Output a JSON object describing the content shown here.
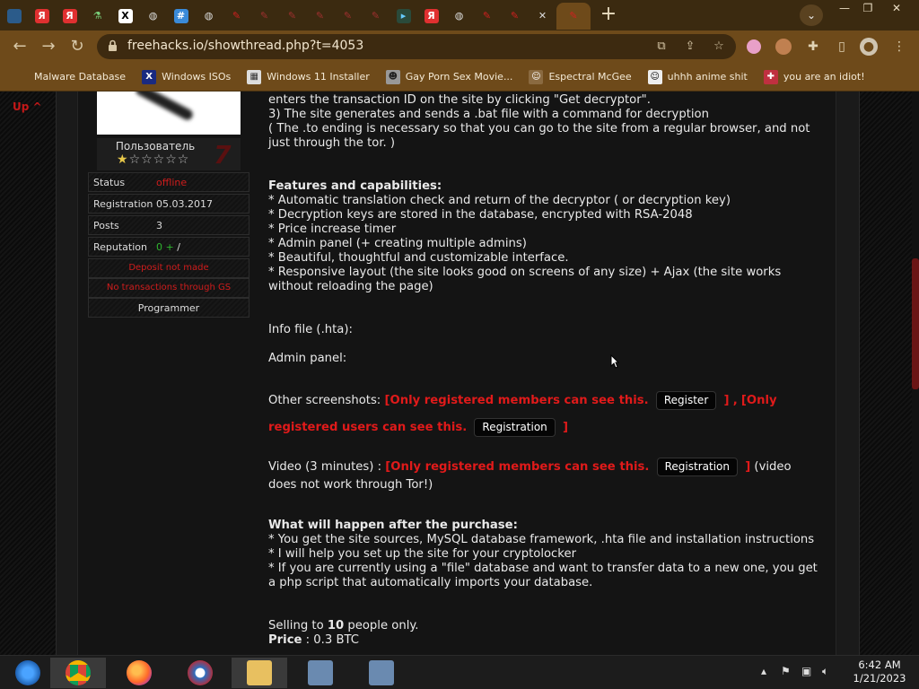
{
  "browser": {
    "url": "freehacks.io/showthread.php?t=4053",
    "tab_count_visible": 24
  },
  "bookmarks": [
    {
      "label": "Malware Database",
      "icon": "generic-page-icon"
    },
    {
      "label": "Windows ISOs",
      "icon": "x-logo-icon"
    },
    {
      "label": "Windows 11 Installer",
      "icon": "image-icon"
    },
    {
      "label": "Gay Porn Sex Movie...",
      "icon": "character-icon"
    },
    {
      "label": "Espectral McGee",
      "icon": "character-icon"
    },
    {
      "label": "uhhh anime shit",
      "icon": "anime-icon"
    },
    {
      "label": "you are an idiot!",
      "icon": "flag-icon"
    }
  ],
  "page": {
    "up_label": "Up ^",
    "user": {
      "rank": "Пользователь",
      "stars": "★★★★★★",
      "rows": [
        {
          "key": "Status",
          "value": "offline"
        },
        {
          "key": "Registration",
          "value": "05.03.2017"
        },
        {
          "key": "Posts",
          "value": "3"
        },
        {
          "key": "Reputation",
          "value_plus": "0 +",
          "value_rest": " /"
        }
      ],
      "deposit": "Deposit not made",
      "transactions": "No transactions through GS",
      "role": "Programmer"
    },
    "post": {
      "line_top": "enters the transaction ID on the site by clicking \"Get decryptor\".",
      "step3": "3) The site generates and sends a .bat file with a command for decryption",
      "note": "( The .to ending is necessary so that you can go to the site from a regular browser, and not just through the tor. )",
      "features_title": "Features and capabilities:",
      "features": [
        "* Automatic translation check and return of the decryptor ( or decryption key)",
        "* Decryption keys are stored in the database, encrypted with RSA-2048",
        "* Price increase timer",
        "* Admin panel (+ creating multiple admins)",
        "* Beautiful, thoughtful and customizable interface.",
        "* Responsive layout (the site looks good on screens of any size) + Ajax (the site works without reloading the page)"
      ],
      "info_file": "Info file (.hta):",
      "admin_panel": "Admin panel:",
      "other_screens_label": "Other screenshots:",
      "hidden_members": "[Only registered members can see this.",
      "hidden_users": "[Only registered users can see this.",
      "register_btn": "Register",
      "registration_btn": "Registration",
      "bracket_close": "]",
      "comma": ",",
      "video_label": "Video (3 minutes) :",
      "video_note": "(video does not work through Tor!)",
      "after_title": "What will happen after the purchase:",
      "after": [
        "* You get the site sources, MySQL database framework, .hta file and installation instructions",
        "* I will help you set up the site for your cryptolocker",
        "* If you are currently using a \"file\" database and want to transfer data to a new one, you get a php script that automatically imports your database."
      ],
      "selling_pre": "Selling to ",
      "selling_num": "10",
      "selling_post": " people only.",
      "price_label": "Price",
      "price_value": " : 0.3 BTC"
    }
  },
  "taskbar": {
    "time": "6:42 AM",
    "date": "1/21/2023"
  },
  "colors": {
    "tabstrip": "#3b2a10",
    "toolbar": "#6e4a1a",
    "accent_red": "#e01a1a"
  }
}
